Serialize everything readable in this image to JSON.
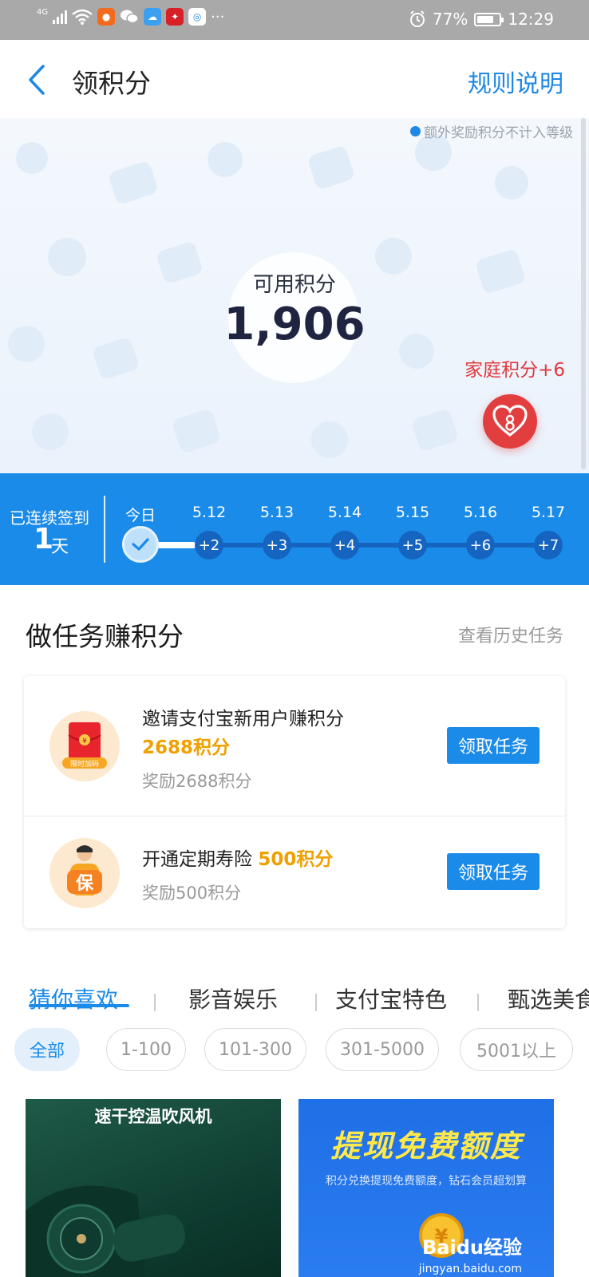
{
  "status_bar": {
    "network": "4G",
    "battery": "77%",
    "battery_level": 0.77,
    "time": "12:29",
    "more": "···"
  },
  "header": {
    "title": "领积分",
    "rules_link": "规则说明"
  },
  "hero": {
    "note": "额外奖励积分不计入等级",
    "points_label": "可用积分",
    "points_value": "1,906",
    "family_points": "家庭积分+6"
  },
  "checkin": {
    "streak_label": "已连续签到",
    "streak_days": "1",
    "streak_unit": "天",
    "days": [
      {
        "date": "今日",
        "reward": ""
      },
      {
        "date": "5.12",
        "reward": "+2"
      },
      {
        "date": "5.13",
        "reward": "+3"
      },
      {
        "date": "5.14",
        "reward": "+4"
      },
      {
        "date": "5.15",
        "reward": "+5"
      },
      {
        "date": "5.16",
        "reward": "+6"
      },
      {
        "date": "5.17",
        "reward": "+7"
      }
    ]
  },
  "tasks": {
    "title": "做任务赚积分",
    "history_link": "查看历史任务",
    "items": [
      {
        "name": "邀请支付宝新用户赚积分",
        "points": "2688积分",
        "reward": "奖励2688积分",
        "button": "领取任务",
        "icon_badge": "限时加码",
        "icon_symbol": "¥"
      },
      {
        "name": "开通定期寿险",
        "points": "500积分",
        "reward": "奖励500积分",
        "button": "领取任务",
        "icon_symbol": "保"
      }
    ]
  },
  "categories": {
    "tabs": [
      "猜你喜欢",
      "影音娱乐",
      "支付宝特色",
      "甄选美食"
    ],
    "filters": [
      "全部",
      "1-100",
      "101-300",
      "301-5000",
      "5001以上"
    ]
  },
  "products": [
    {
      "title": "速干控温吹风机"
    },
    {
      "title": "提现免费额度",
      "subtitle": "积分兑换提现免费额度，钻石会员超划算"
    }
  ],
  "watermark": {
    "brand": "Baidu经验",
    "url": "jingyan.baidu.com"
  },
  "colors": {
    "accent": "#1b8be9",
    "points_orange": "#f0a000",
    "family_red": "#e0383b"
  }
}
